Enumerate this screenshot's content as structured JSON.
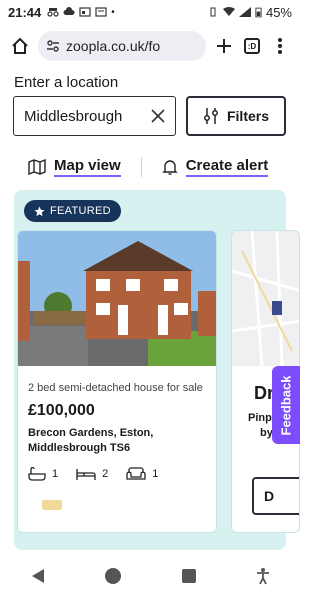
{
  "status_bar": {
    "time": "21:44",
    "battery": "45%"
  },
  "browser": {
    "url": "zoopla.co.uk/fo",
    "tab_count": ":D"
  },
  "search": {
    "location_label": "Enter a location",
    "location_value": "Middlesbrough",
    "filters_label": "Filters"
  },
  "actions": {
    "map_view": "Map view",
    "create_alert": "Create alert"
  },
  "featured": {
    "badge": "FEATURED"
  },
  "listing": {
    "type": "2 bed semi-detached house for sale",
    "price": "£100,000",
    "address_line1": "Brecon Gardens, Eston,",
    "address_line2": "Middlesbrough TS6",
    "bathrooms": "1",
    "bedrooms": "2",
    "receptions": "1"
  },
  "listing2": {
    "title_partial": "Dr",
    "line1": "Pinpo",
    "line2": "by",
    "cta_partial": "D"
  },
  "feedback": {
    "label": "Feedback"
  },
  "colors": {
    "accent": "#7b61ff",
    "featured_bg": "#d6f1f0",
    "badge_bg": "#17345a",
    "feedback_bg": "#7b4dff"
  }
}
